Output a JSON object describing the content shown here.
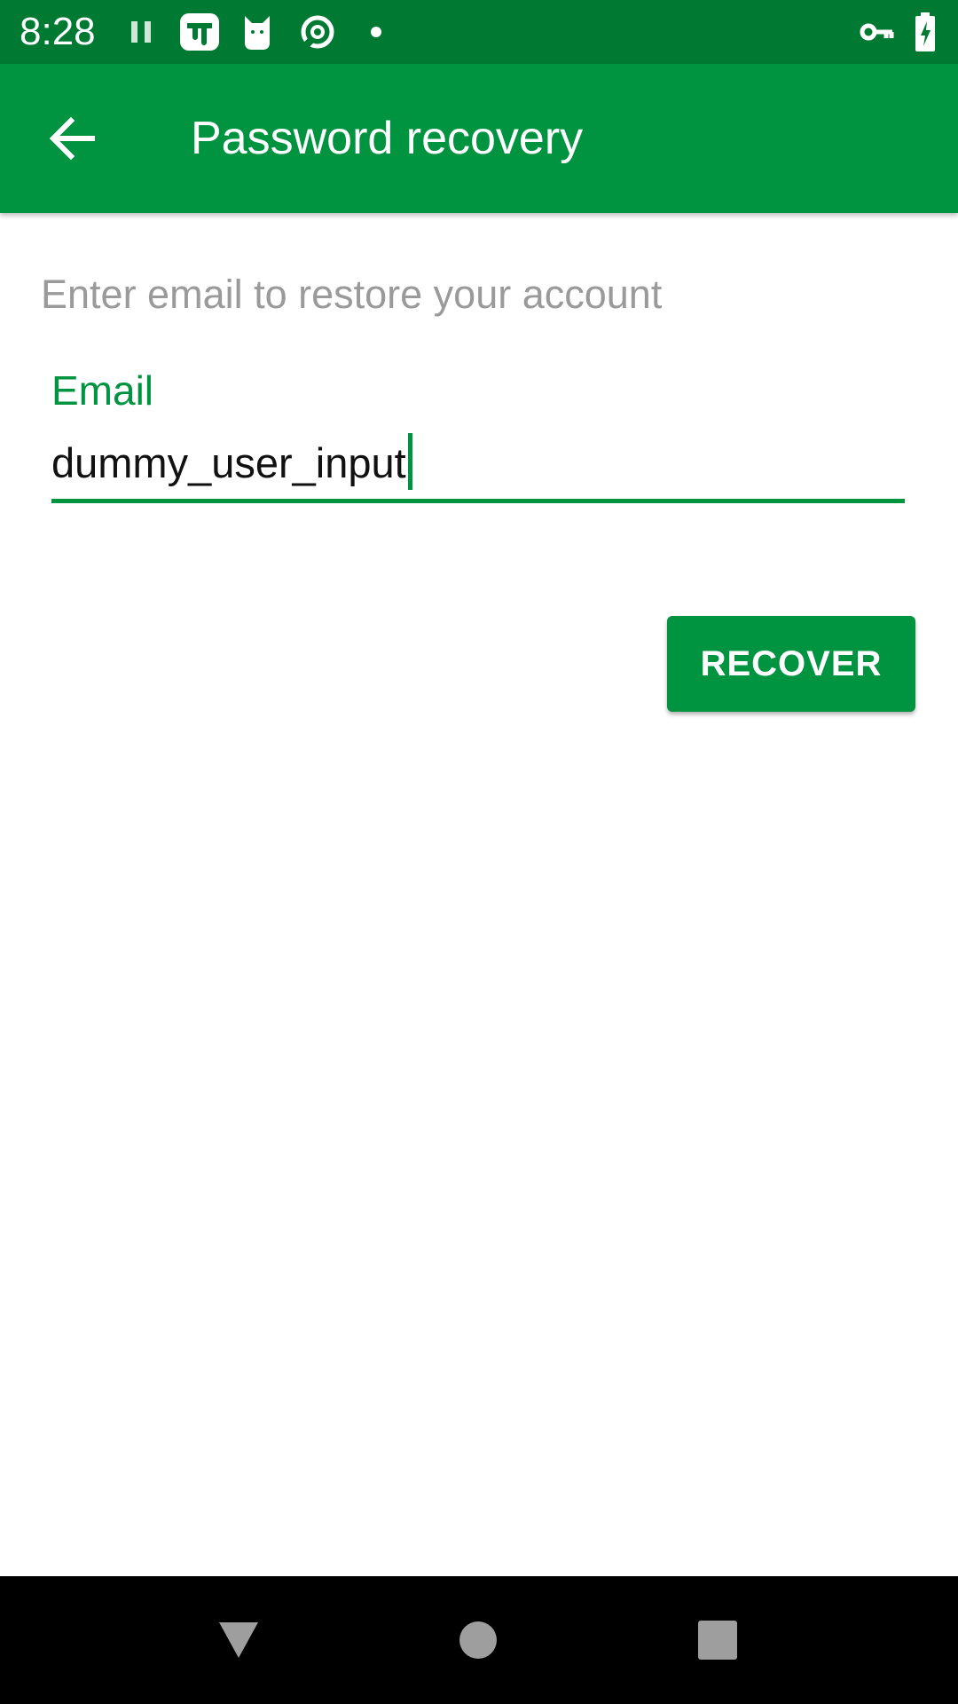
{
  "status_bar": {
    "time": "8:28",
    "icons": [
      "pause-icon",
      "app-notification-icon",
      "cat-icon",
      "podcast-icon",
      "dot-icon",
      "vpn-key-icon",
      "battery-charging-icon"
    ],
    "background_color": "#007a33"
  },
  "app_bar": {
    "title": "Password recovery",
    "back_icon": "arrow-back-icon",
    "background_color": "#009340"
  },
  "content": {
    "instruction": "Enter email to restore your account",
    "email_field": {
      "label": "Email",
      "value": "dummy_user_input",
      "accent_color": "#009340"
    },
    "recover_button": {
      "label": "RECOVER"
    }
  },
  "nav_bar": {
    "items": [
      "back-triangle-icon",
      "home-circle-icon",
      "recents-square-icon"
    ]
  }
}
